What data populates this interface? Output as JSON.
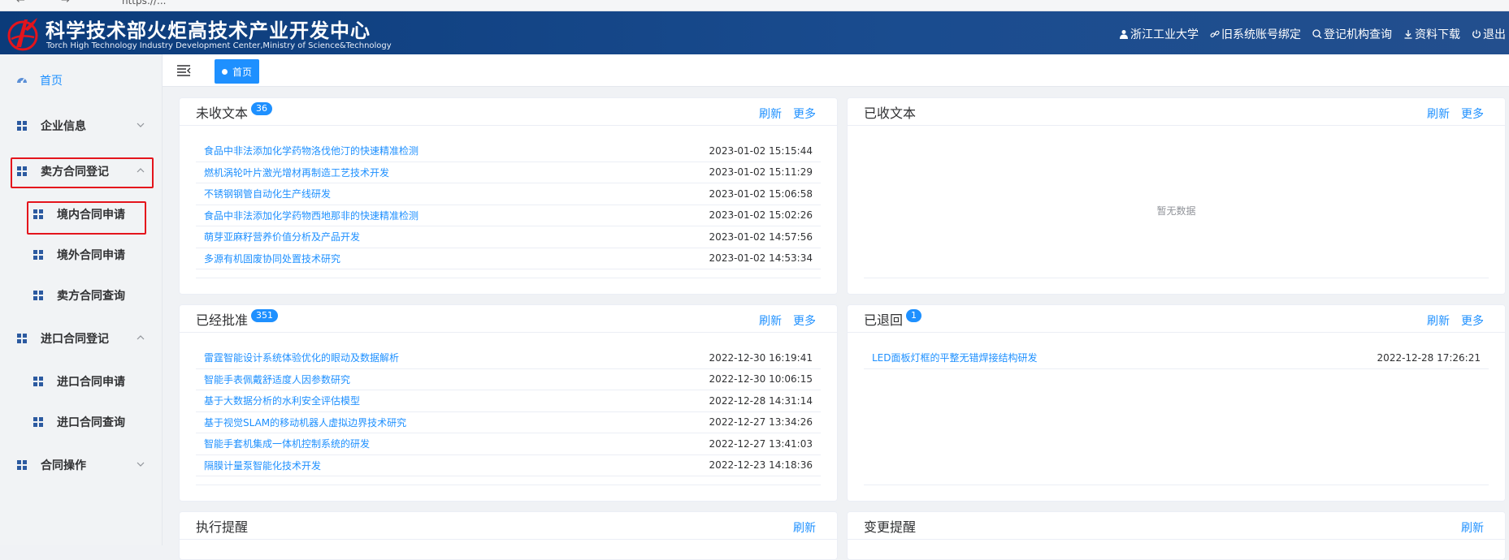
{
  "browser": {
    "url": "https://...",
    "nav": "← →"
  },
  "header": {
    "title_cn": "科学技术部火炬高技术产业开发中心",
    "title_en": "Torch High Technology Industry Development Center,Ministry of Science&Technology",
    "links": [
      {
        "icon": "user-icon",
        "label": "浙江工业大学"
      },
      {
        "icon": "link-icon",
        "label": "旧系统账号绑定"
      },
      {
        "icon": "search-icon",
        "label": "登记机构查询"
      },
      {
        "icon": "download-icon",
        "label": "资料下载"
      },
      {
        "icon": "power-icon",
        "label": "退出"
      }
    ]
  },
  "sidebar": {
    "home": "首页",
    "enterprise": "企业信息",
    "seller_contract": "卖方合同登记",
    "domestic_apply": "境内合同申请",
    "foreign_apply": "境外合同申请",
    "seller_query": "卖方合同查询",
    "import_contract": "进口合同登记",
    "import_apply": "进口合同申请",
    "import_query": "进口合同查询",
    "contract_ops": "合同操作"
  },
  "tabs": {
    "home": "首页"
  },
  "colors": {
    "accent": "#1e90ff",
    "header": "#0b3b7a",
    "highlight": "#e4141c"
  },
  "panels": {
    "unreceived": {
      "title": "未收文本",
      "count": "36",
      "refresh": "刷新",
      "more": "更多",
      "rows": [
        {
          "title": "食品中非法添加化学药物洛伐他汀的快速精准检测",
          "date": "2023-01-02 15:15:44"
        },
        {
          "title": "燃机涡轮叶片激光增材再制造工艺技术开发",
          "date": "2023-01-02 15:11:29"
        },
        {
          "title": "不锈钢钢管自动化生产线研发",
          "date": "2023-01-02 15:06:58"
        },
        {
          "title": "食品中非法添加化学药物西地那非的快速精准检测",
          "date": "2023-01-02 15:02:26"
        },
        {
          "title": "萌芽亚麻籽营养价值分析及产品开发",
          "date": "2023-01-02 14:57:56"
        },
        {
          "title": "多源有机固废协同处置技术研究",
          "date": "2023-01-02 14:53:34"
        }
      ]
    },
    "received": {
      "title": "已收文本",
      "refresh": "刷新",
      "more": "更多",
      "empty": "暂无数据"
    },
    "approved": {
      "title": "已经批准",
      "count": "351",
      "refresh": "刷新",
      "more": "更多",
      "rows": [
        {
          "title": "雷霆智能设计系统体验优化的眼动及数据解析",
          "date": "2022-12-30 16:19:41"
        },
        {
          "title": "智能手表佩戴舒适度人因参数研究",
          "date": "2022-12-30 10:06:15"
        },
        {
          "title": "基于大数据分析的水利安全评估模型",
          "date": "2022-12-28 14:31:14"
        },
        {
          "title": "基于视觉SLAM的移动机器人虚拟边界技术研究",
          "date": "2022-12-27 13:34:26"
        },
        {
          "title": "智能手套机集成一体机控制系统的研发",
          "date": "2022-12-27 13:41:03"
        },
        {
          "title": "隔膜计量泵智能化技术开发",
          "date": "2022-12-23 14:18:36"
        }
      ]
    },
    "returned": {
      "title": "已退回",
      "count": "1",
      "refresh": "刷新",
      "more": "更多",
      "rows": [
        {
          "title": "LED面板灯框的平整无错焊接结构研发",
          "date": "2022-12-28 17:26:21"
        }
      ]
    },
    "execution": {
      "title": "执行提醒",
      "refresh": "刷新"
    },
    "change": {
      "title": "变更提醒",
      "refresh": "刷新"
    }
  }
}
